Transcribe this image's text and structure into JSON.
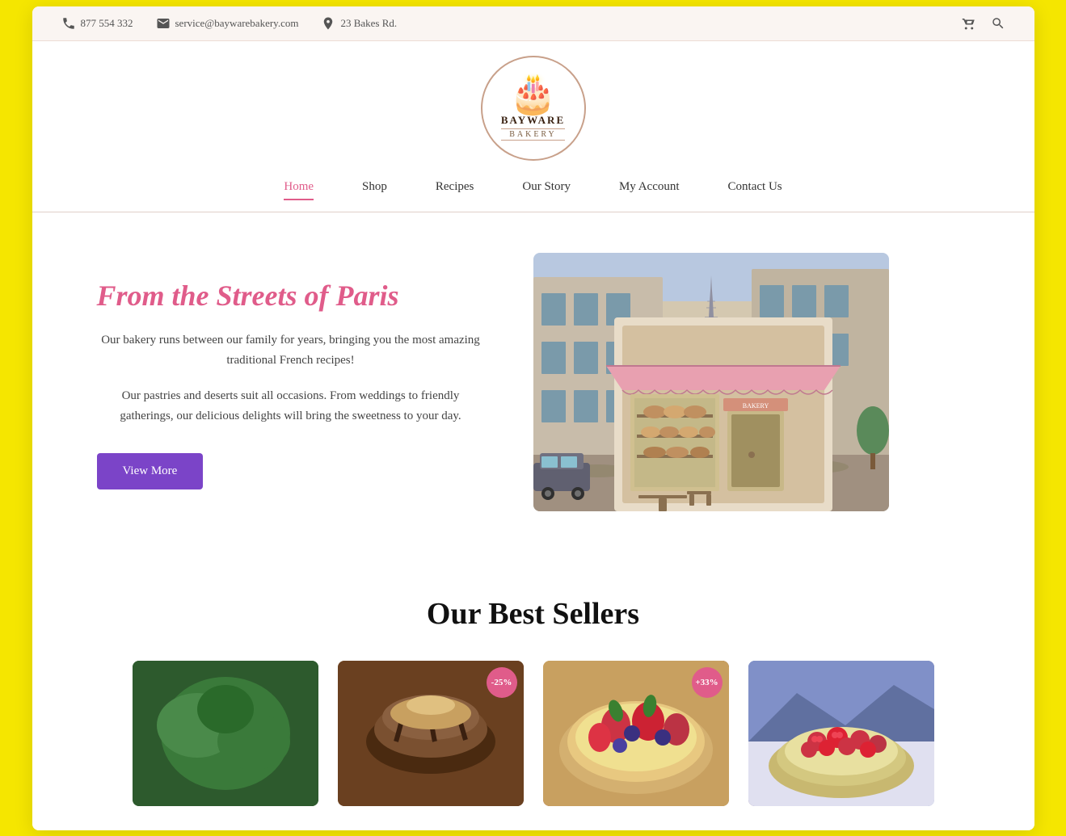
{
  "page": {
    "border_color": "#f5e600"
  },
  "topbar": {
    "phone": "877 554 332",
    "email": "service@baywarebakery.com",
    "address": "23 Bakes Rd."
  },
  "logo": {
    "name_line1": "BAYWARE",
    "name_line2": "BAKERY",
    "cake_emoji": "🎂"
  },
  "nav": {
    "items": [
      {
        "label": "Home",
        "active": true
      },
      {
        "label": "Shop",
        "active": false
      },
      {
        "label": "Recipes",
        "active": false
      },
      {
        "label": "Our Story",
        "active": false
      },
      {
        "label": "My Account",
        "active": false
      },
      {
        "label": "Contact Us",
        "active": false
      }
    ]
  },
  "hero": {
    "title": "From the Streets of Paris",
    "desc1": "Our bakery runs between our family for years, bringing you the most amazing traditional French recipes!",
    "desc2": "Our pastries and deserts suit all occasions. From weddings to friendly gatherings, our delicious delights will bring the sweetness to your day.",
    "button_label": "View More"
  },
  "best_sellers": {
    "section_title": "Our Best Sellers",
    "products": [
      {
        "id": 1,
        "badge": null,
        "color_class": "prod1"
      },
      {
        "id": 2,
        "badge": "-25%",
        "color_class": "prod2"
      },
      {
        "id": 3,
        "badge": "+ 33%",
        "color_class": "prod3"
      },
      {
        "id": 4,
        "badge": null,
        "color_class": "prod4"
      }
    ]
  }
}
